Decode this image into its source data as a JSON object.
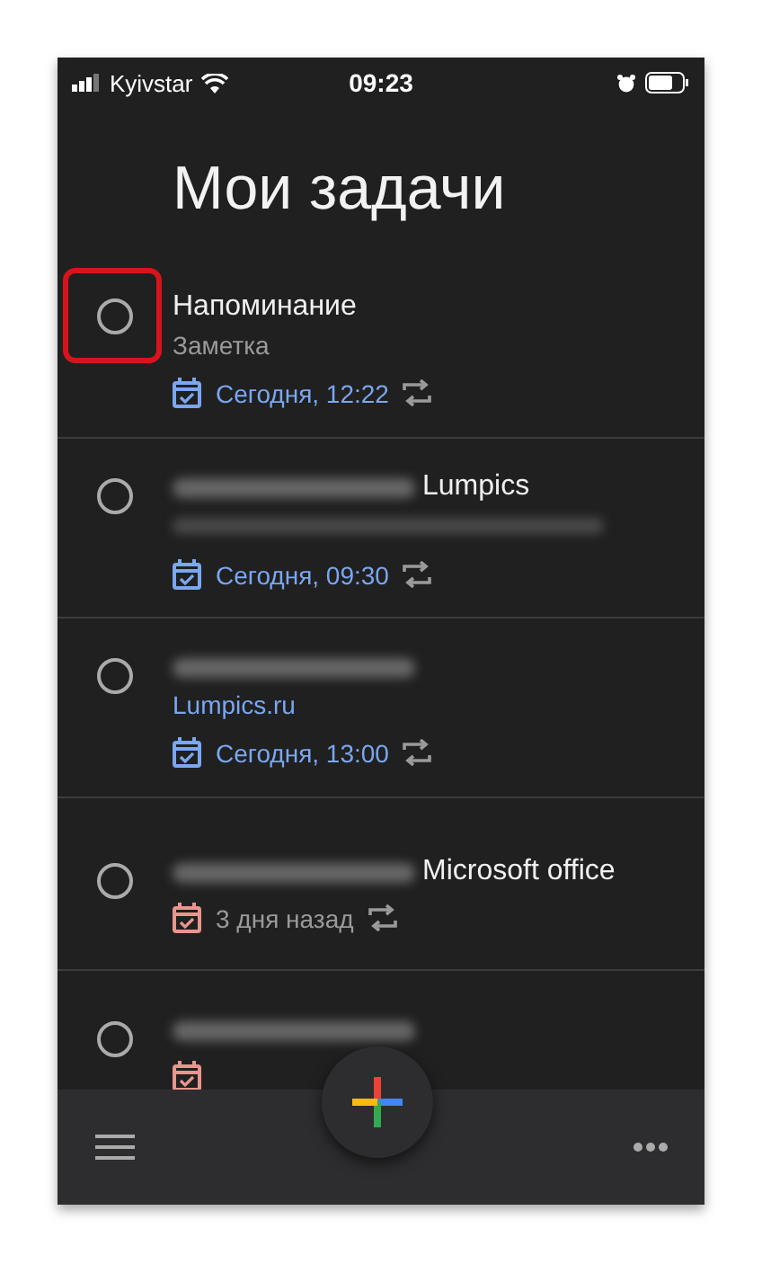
{
  "status_bar": {
    "carrier": "Kyivstar",
    "time": "09:23"
  },
  "title": "Мои задачи",
  "tasks": [
    {
      "checked": false,
      "highlighted": true,
      "title": "Напоминание",
      "title_redacted": false,
      "note": {
        "text": "Заметка",
        "link": false
      },
      "date": "Сегодня, 12:22",
      "overdue": false,
      "repeat": true
    },
    {
      "checked": false,
      "highlighted": false,
      "title": "Lumpics",
      "title_redacted": true,
      "note_redacted": true,
      "date": "Сегодня, 09:30",
      "overdue": false,
      "repeat": true
    },
    {
      "checked": false,
      "highlighted": false,
      "title_redacted": true,
      "note": {
        "text": "Lumpics.ru",
        "link": true
      },
      "date": "Сегодня, 13:00",
      "overdue": false,
      "repeat": true
    },
    {
      "checked": false,
      "highlighted": false,
      "title": "Microsoft office",
      "title_redacted": true,
      "date": "3 дня назад",
      "overdue": true,
      "repeat": true
    },
    {
      "checked": false,
      "highlighted": false,
      "title_redacted": true,
      "overdue": true
    }
  ]
}
